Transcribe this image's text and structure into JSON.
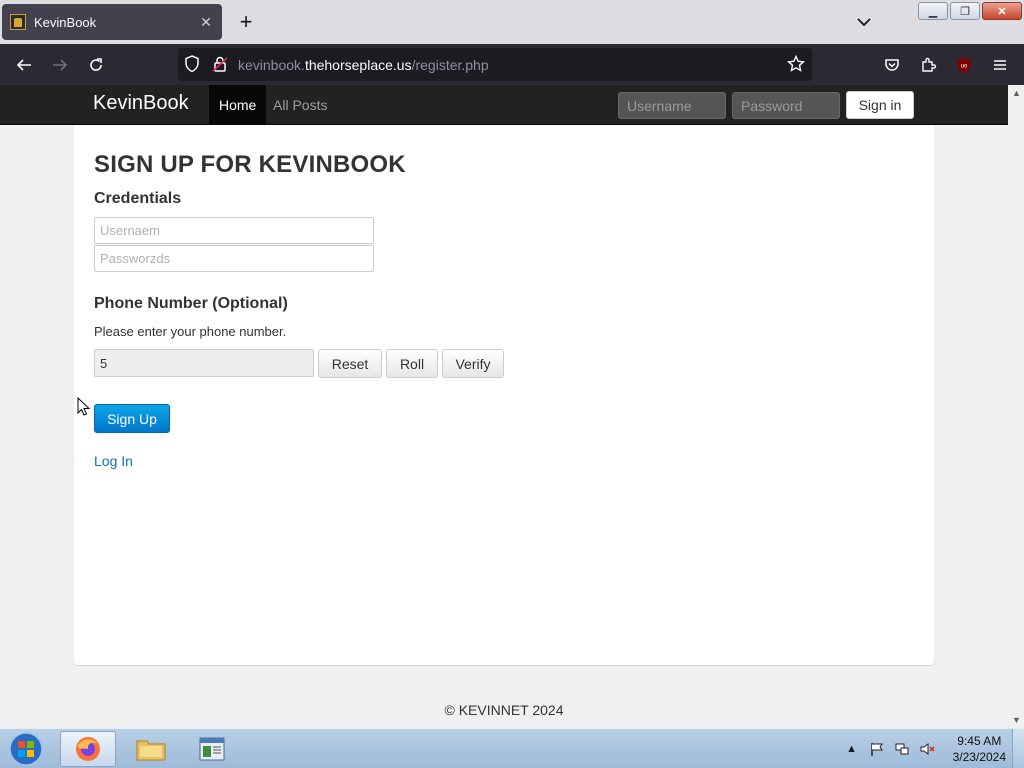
{
  "browser": {
    "tab_title": "KevinBook",
    "tab_close": "✕",
    "new_tab": "+",
    "url_prefix": "kevinbook.",
    "url_host": "thehorseplace.us",
    "url_path": "/register.php"
  },
  "site": {
    "brand": "KevinBook",
    "nav": [
      {
        "label": "Home",
        "active": true
      },
      {
        "label": "All Posts",
        "active": false
      }
    ],
    "username_placeholder": "Username",
    "password_placeholder": "Password",
    "signin_label": "Sign in"
  },
  "form": {
    "title": "SIGN UP FOR KEVINBOOK",
    "credentials_heading": "Credentials",
    "username_placeholder": "Usernaem",
    "password_placeholder": "Passworzds",
    "phone_heading": "Phone Number (Optional)",
    "phone_help": "Please enter your phone number.",
    "phone_value": "5",
    "reset_label": "Reset",
    "roll_label": "Roll",
    "verify_label": "Verify",
    "signup_label": "Sign Up",
    "login_link": "Log In"
  },
  "footer": {
    "text": "© KEVINNET 2024"
  },
  "taskbar": {
    "time": "9:45 AM",
    "date": "3/23/2024"
  },
  "colors": {
    "primary_button": "#0077c9",
    "link": "#0d6fb8",
    "navbar": "#222222"
  }
}
